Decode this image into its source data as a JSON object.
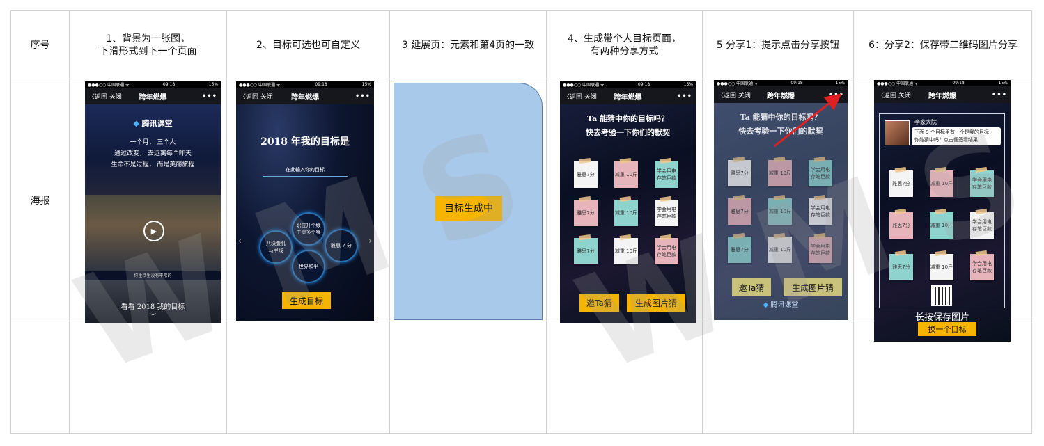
{
  "table": {
    "headers": [
      "序号",
      "1、背景为一张图，\n下滑形式到下一个页面",
      "2、目标可选也可自定义",
      "3 延展页：元素和第4页的一致",
      "4、生成带个人目标页面，\n有两种分享方式",
      "5 分享1：提示点击分享按钮",
      "6：分享2：保存带二维码图片分享"
    ],
    "row_label": "海报"
  },
  "phone_common": {
    "carrier": "●●●○○ 中国联通 ᯤ",
    "time": "09:18",
    "battery": "15%",
    "back": "〈返回  关闭",
    "title": "跨年燃爆",
    "more": "•••"
  },
  "p1": {
    "brand": "腾讯课堂",
    "line1": "一个月，   三个人",
    "line2": "通过改变，  去远离每个昨天",
    "line3": "生命不是过程，  而是美丽旅程",
    "caption": "你生活里没有平常的",
    "cta": "看看 2018 我的目标"
  },
  "p2": {
    "heading": "2018 年我的目标是",
    "input_hint": "在此输入你的目标",
    "opt1": "职位升个级\n工资多个零",
    "opt2": "八块腹肌\n马甲线",
    "opt3": "雅思 7 分",
    "opt4": "世界和平",
    "button": "生成目标"
  },
  "p3": {
    "label": "目标生成中"
  },
  "p4": {
    "line1": "Ta 能猜中你的目标吗？",
    "line2": "快去考验一下你们的默契",
    "notes": [
      "雅思7分",
      "减重 10斤",
      "学会用电\n存笔巨款",
      "雅思7分",
      "减重 10斤",
      "学会用电\n存笔巨款",
      "雅思7分",
      "减重 10斤",
      "学会用电\n存笔巨款"
    ],
    "btn1": "邀Ta猜",
    "btn2": "生成图片猜"
  },
  "p5": {
    "line1": "Ta 能猜中你的目标吗？",
    "line2": "快去考验一下你们的默契",
    "notes": [
      "雅思7分",
      "减重 10斤",
      "学会用电\n存笔巨款",
      "雅思7分",
      "减重 10斤",
      "学会用电\n存笔巨款",
      "雅思7分",
      "减重 10斤",
      "学会用电\n存笔巨款"
    ],
    "btn1": "邀Ta猜",
    "btn2": "生成图片猜",
    "brand": "腾讯课堂"
  },
  "p6": {
    "username": "李家大院",
    "bubble": "下面 9 个目标里有一个是我的目标，你能猜中吗？点击便签看结果",
    "notes": [
      "雅思7分",
      "减重 10斤",
      "学会用电\n存笔巨款",
      "雅思7分",
      "减重 10斤",
      "学会用电\n存笔巨款",
      "雅思7分",
      "减重 10斤",
      "学会用电\n存笔巨款"
    ],
    "save_hint": "长按保存图片",
    "button": "换一个目标"
  },
  "watermark": "WMS",
  "colors": {
    "yellow": "#f4b400",
    "light_blue": "#a9c9ea",
    "arrow": "#e02020",
    "note_colors": [
      "#f4f4f4",
      "#e8b4bc",
      "#8fd3cf",
      "#e8b4bc",
      "#8fd3cf",
      "#f4f4f4",
      "#8fd3cf",
      "#f4f4f4",
      "#e8b4bc"
    ]
  }
}
